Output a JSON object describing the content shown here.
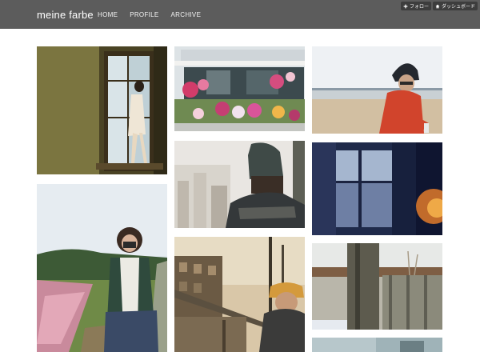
{
  "site": {
    "title": "meine farbe"
  },
  "nav": {
    "items": [
      "HOME",
      "PROFILE",
      "ARCHIVE"
    ]
  },
  "tumblr": {
    "follow_label": "フォロー",
    "dashboard_label": "ダッシュボード"
  },
  "colors": {
    "header_bg": "#5c5c5c",
    "page_bg": "#ffffff",
    "control_bg": "#3d3d3d"
  }
}
